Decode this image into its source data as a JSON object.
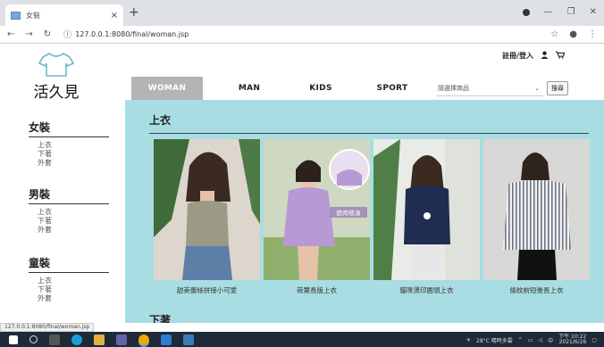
{
  "browser": {
    "tab_title": "女裝",
    "tab_close": "×",
    "new_tab": "+",
    "url": "127.0.0.1:8080/final/woman.jsp",
    "status_url": "127.0.0.1:8080/final/woman.jsp"
  },
  "header": {
    "logo_text": "活久見",
    "login_label": "註冊/登入"
  },
  "nav": {
    "tabs": [
      "WOMAN",
      "MAN",
      "KIDS",
      "SPORT"
    ],
    "search_placeholder": "請選擇商品",
    "search_button": "搜尋"
  },
  "sidebar": {
    "categories": [
      {
        "title": "女裝",
        "items": [
          "上衣",
          "下著",
          "外套"
        ]
      },
      {
        "title": "男裝",
        "items": [
          "上衣",
          "下著",
          "外套"
        ]
      },
      {
        "title": "童裝",
        "items": [
          "上衣",
          "下著",
          "外套"
        ]
      }
    ]
  },
  "main": {
    "section_title": "上衣",
    "next_section_title": "下著",
    "products": [
      {
        "name": "甜美蕾絲拼接小可愛",
        "badge": ""
      },
      {
        "name": "荷葉長版上衣",
        "badge": "遮肉修身"
      },
      {
        "name": "貓咪燙印圓領上衣",
        "badge": ""
      },
      {
        "name": "條紋前短後長上衣",
        "badge": ""
      }
    ]
  },
  "taskbar": {
    "weather": "28°C 晴時多雲",
    "time": "下午 10:22",
    "date": "2021/6/26",
    "ime": "中"
  }
}
